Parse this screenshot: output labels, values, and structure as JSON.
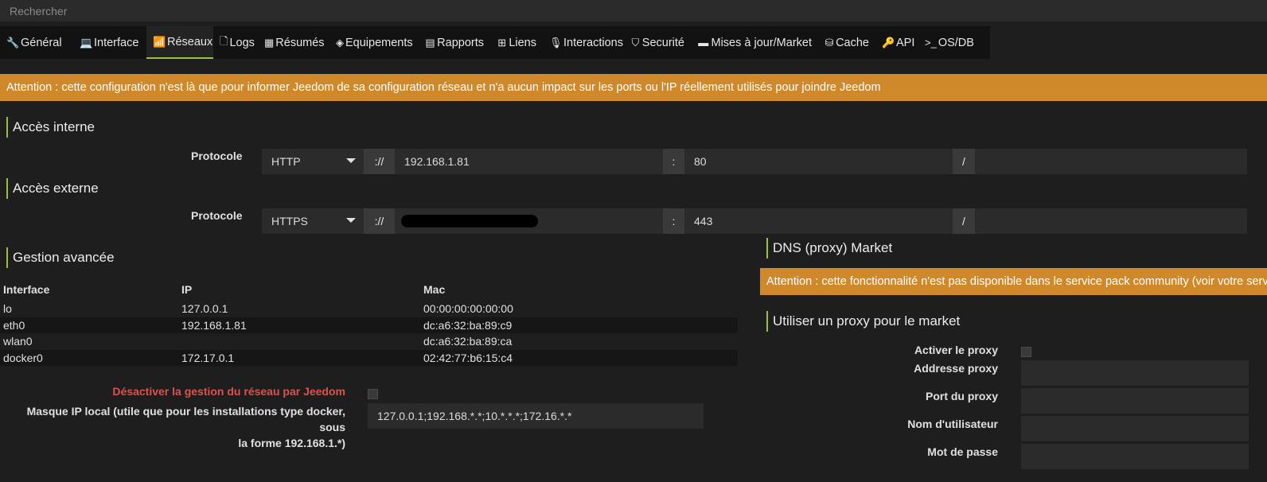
{
  "search": {
    "placeholder": "Rechercher"
  },
  "tabs": [
    {
      "label": "Général",
      "icon": "wrench-icon"
    },
    {
      "label": "Interface",
      "icon": "laptop-icon"
    },
    {
      "label": "Réseaux",
      "icon": "rss-icon"
    },
    {
      "label": "Logs",
      "icon": "file-icon"
    },
    {
      "label": "Résumés",
      "icon": "table-icon"
    },
    {
      "label": "Equipements",
      "icon": "cube-icon"
    },
    {
      "label": "Rapports",
      "icon": "report-icon"
    },
    {
      "label": "Liens",
      "icon": "sitemap-icon"
    },
    {
      "label": "Interactions",
      "icon": "microphone-icon"
    },
    {
      "label": "Securité",
      "icon": "shield-icon"
    },
    {
      "label": "Mises à jour/Market",
      "icon": "credit-card-icon"
    },
    {
      "label": "Cache",
      "icon": "hdd-icon"
    },
    {
      "label": "API",
      "icon": "key-icon"
    },
    {
      "label": "OS/DB",
      "icon": "terminal-icon"
    }
  ],
  "active_tab": "Réseaux",
  "warning": "Attention : cette configuration n'est là que pour informer Jeedom de sa configuration réseau et n'a aucun impact sur les ports ou l'IP réellement utilisés pour joindre Jeedom",
  "internal": {
    "title": "Accès interne",
    "protocol_label": "Protocole",
    "protocol": "HTTP",
    "sep": "://",
    "host": "192.168.1.81",
    "colon": ":",
    "port": "80",
    "slash": "/",
    "path": ""
  },
  "external": {
    "title": "Accès externe",
    "protocol_label": "Protocole",
    "protocol": "HTTPS",
    "sep": "://",
    "host": "",
    "colon": ":",
    "port": "443",
    "slash": "/",
    "path": ""
  },
  "advanced": {
    "title": "Gestion avancée",
    "columns": [
      "Interface",
      "IP",
      "Mac"
    ],
    "rows": [
      [
        "lo",
        "127.0.0.1",
        "00:00:00:00:00:00"
      ],
      [
        "eth0",
        "192.168.1.81",
        "dc:a6:32:ba:89:c9"
      ],
      [
        "wlan0",
        "",
        "dc:a6:32:ba:89:ca"
      ],
      [
        "docker0",
        "172.17.0.1",
        "02:42:77:b6:15:c4"
      ]
    ],
    "disable_label": "Désactiver la gestion du réseau par Jeedom",
    "mask_label_1": "Masque IP local (utile que pour les installations type docker, sous",
    "mask_label_2": "la forme 192.168.1.*)",
    "mask_value": "127.0.0.1;192.168.*.*;10.*.*.*;172.16.*.*"
  },
  "dns": {
    "title": "DNS (proxy) Market",
    "warning": "Attention : cette fonctionnalité n'est pas disponible dans le service pack community (voir votre service pack)"
  },
  "proxy": {
    "title": "Utiliser un proxy pour le market",
    "enable_label": "Activer le proxy",
    "address_label": "Addresse proxy",
    "port_label": "Port du proxy",
    "user_label": "Nom d'utilisateur",
    "password_label": "Mot de passe"
  },
  "colors": {
    "accent": "#9ac13a",
    "warning": "#d0892a",
    "danger": "#d9534f"
  }
}
